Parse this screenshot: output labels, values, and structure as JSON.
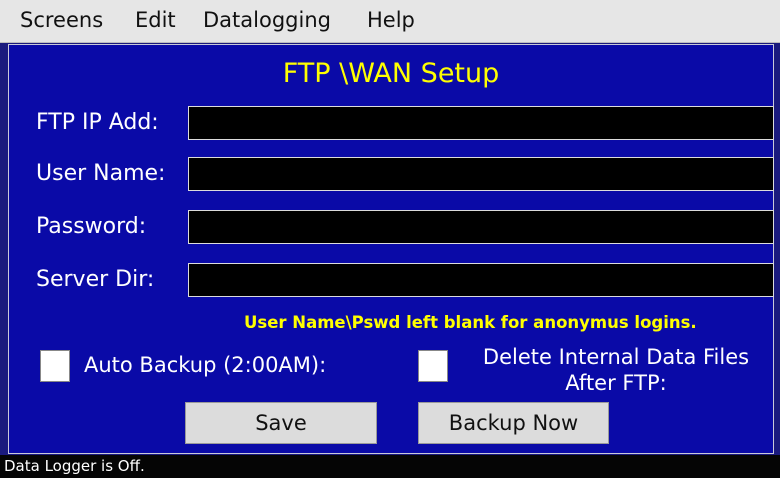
{
  "menu": {
    "items": [
      "Screens",
      "Edit",
      "Datalogging",
      "Help"
    ]
  },
  "screen": {
    "title": "FTP \\WAN Setup"
  },
  "form": {
    "fields": [
      {
        "label": "FTP IP Add:",
        "value": ""
      },
      {
        "label": "User Name:",
        "value": ""
      },
      {
        "label": "Password:",
        "value": ""
      },
      {
        "label": "Server Dir:",
        "value": ""
      }
    ],
    "hint": "User Name\\Pswd left blank for anonymus logins.",
    "auto_backup": {
      "label": "Auto Backup (2:00AM):",
      "checked": false
    },
    "delete_files": {
      "label_line1": "Delete Internal Data Files",
      "label_line2": "After FTP:",
      "checked": false
    }
  },
  "buttons": {
    "save": "Save",
    "backup_now": "Backup Now"
  },
  "status": {
    "text": "Data Logger is Off."
  },
  "colors": {
    "panel_bg": "#0a0aa7",
    "title": "#ffff00",
    "hint": "#ffff00",
    "field_bg": "#000000",
    "status_bg": "#050505"
  }
}
